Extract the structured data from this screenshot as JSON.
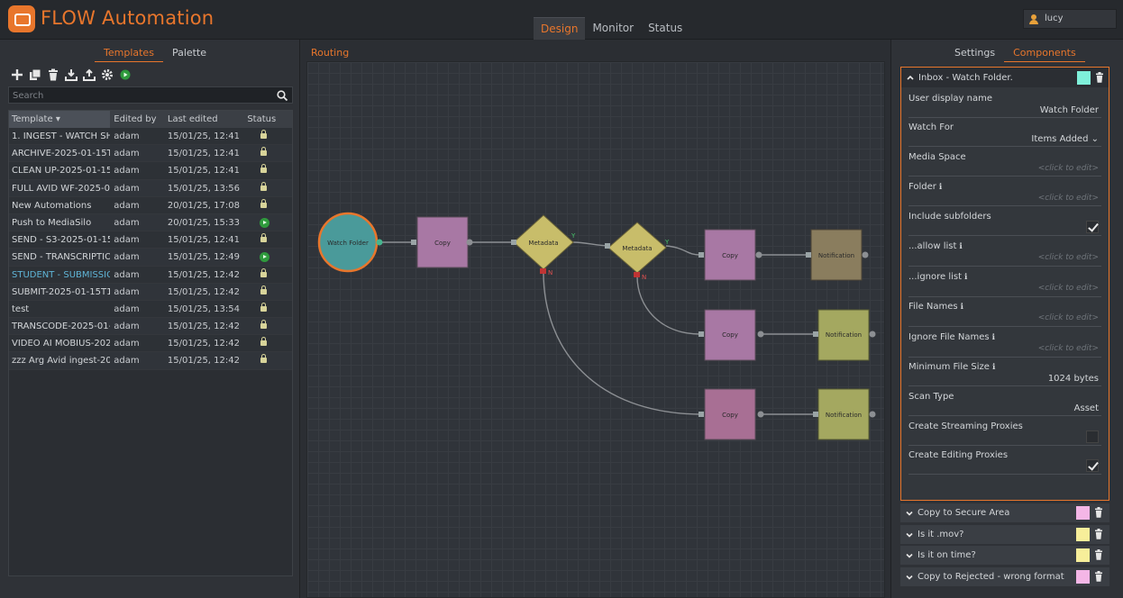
{
  "app": {
    "title": "FLOW Automation"
  },
  "main_tabs": [
    {
      "label": "Design",
      "active": true
    },
    {
      "label": "Monitor",
      "active": false
    },
    {
      "label": "Status",
      "active": false
    }
  ],
  "user": {
    "name": "lucy"
  },
  "left": {
    "tabs": [
      {
        "label": "Templates",
        "active": true
      },
      {
        "label": "Palette",
        "active": false
      }
    ],
    "search_placeholder": "Search",
    "columns": {
      "template": "Template",
      "edited_by": "Edited by",
      "last_edited": "Last edited",
      "status": "Status"
    },
    "rows": [
      {
        "name": "1. INGEST - WATCH SH",
        "by": "adam",
        "date": "15/01/25, 12:41",
        "status": "locked"
      },
      {
        "name": "ARCHIVE-2025-01-15T1",
        "by": "adam",
        "date": "15/01/25, 12:41",
        "status": "locked"
      },
      {
        "name": "CLEAN UP-2025-01-15T",
        "by": "adam",
        "date": "15/01/25, 12:41",
        "status": "locked"
      },
      {
        "name": "FULL AVID WF-2025-01",
        "by": "adam",
        "date": "15/01/25, 13:56",
        "status": "locked"
      },
      {
        "name": "New Automations",
        "by": "adam",
        "date": "20/01/25, 17:08",
        "status": "locked"
      },
      {
        "name": "Push to MediaSilo",
        "by": "adam",
        "date": "20/01/25, 15:33",
        "status": "running"
      },
      {
        "name": "SEND - S3-2025-01-151",
        "by": "adam",
        "date": "15/01/25, 12:41",
        "status": "locked"
      },
      {
        "name": "SEND - TRANSCRIPTIO",
        "by": "adam",
        "date": "15/01/25, 12:49",
        "status": "running"
      },
      {
        "name": "STUDENT - SUBMISSIO",
        "by": "adam",
        "date": "15/01/25, 12:42",
        "status": "locked",
        "highlight": true
      },
      {
        "name": "SUBMIT-2025-01-15T1",
        "by": "adam",
        "date": "15/01/25, 12:42",
        "status": "locked"
      },
      {
        "name": "test",
        "by": "adam",
        "date": "15/01/25, 13:54",
        "status": "locked"
      },
      {
        "name": "TRANSCODE-2025-01-1",
        "by": "adam",
        "date": "15/01/25, 12:42",
        "status": "locked"
      },
      {
        "name": "VIDEO AI MOBIUS-202",
        "by": "adam",
        "date": "15/01/25, 12:42",
        "status": "locked"
      },
      {
        "name": "zzz Arg Avid ingest-202",
        "by": "adam",
        "date": "15/01/25, 12:42",
        "status": "locked"
      }
    ]
  },
  "routing": {
    "title": "Routing",
    "nodes": {
      "watch": "Watch Folder",
      "copy1": "Copy",
      "meta1": "Metadata",
      "meta2": "Metadata",
      "copy2": "Copy",
      "notif1": "Notification",
      "copy3": "Copy",
      "notif2": "Notification",
      "copy4": "Copy",
      "notif3": "Notification"
    },
    "yes": "Y",
    "no": "N"
  },
  "right": {
    "tabs": [
      {
        "label": "Settings",
        "active": false
      },
      {
        "label": "Components",
        "active": true
      }
    ],
    "active_component": {
      "title": "Inbox - Watch Folder.",
      "color": "#7ff0da",
      "fields": [
        {
          "label": "User display name",
          "value": "Watch Folder",
          "kind": "value"
        },
        {
          "label": "Watch For",
          "value": "Items Added",
          "kind": "select"
        },
        {
          "label": "Media Space",
          "value": "<click to edit>",
          "kind": "placeholder"
        },
        {
          "label": "Folder",
          "value": "<click to edit>",
          "kind": "placeholder",
          "info": true
        },
        {
          "label": "Include subfolders",
          "kind": "check",
          "checked": true
        },
        {
          "label": "...allow list",
          "value": "<click to edit>",
          "kind": "placeholder",
          "info": true
        },
        {
          "label": "...ignore list",
          "value": "<click to edit>",
          "kind": "placeholder",
          "info": true
        },
        {
          "label": "File Names",
          "value": "<click to edit>",
          "kind": "placeholder",
          "info": true
        },
        {
          "label": "Ignore File Names",
          "value": "<click to edit>",
          "kind": "placeholder",
          "info": true
        },
        {
          "label": "Minimum File Size",
          "value": "1024 bytes",
          "kind": "value",
          "info": true
        },
        {
          "label": "Scan Type",
          "value": "Asset",
          "kind": "value"
        },
        {
          "label": "Create Streaming Proxies",
          "kind": "check",
          "checked": false
        },
        {
          "label": "Create Editing Proxies",
          "kind": "check",
          "checked": true
        }
      ]
    },
    "collapsed_components": [
      {
        "title": "Copy to Secure Area",
        "color": "#f4b6e6"
      },
      {
        "title": "Is it .mov?",
        "color": "#f7ee9a"
      },
      {
        "title": "Is it on time?",
        "color": "#f7ee9a"
      },
      {
        "title": "Copy to Rejected - wrong format",
        "color": "#f4b6e6"
      }
    ]
  }
}
